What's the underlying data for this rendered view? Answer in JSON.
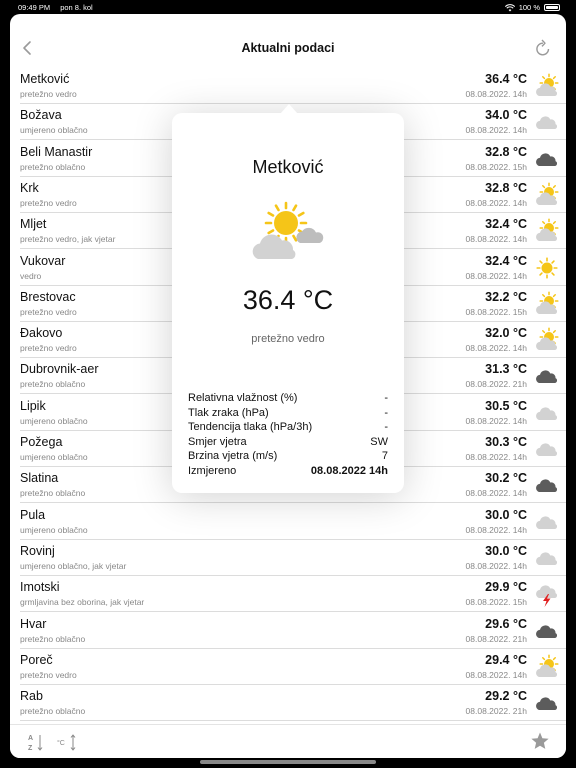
{
  "status_bar": {
    "time": "09:49 PM",
    "date": "pon 8. kol",
    "battery": "100 %"
  },
  "header": {
    "title": "Aktualni podaci"
  },
  "stations": [
    {
      "city": "Metković",
      "desc": "pretežno vedro",
      "temp": "36.4 °C",
      "date": "08.08.2022. 14h",
      "icon": "partly-sunny-icon"
    },
    {
      "city": "Božava",
      "desc": "umjereno oblačno",
      "temp": "34.0 °C",
      "date": "08.08.2022. 14h",
      "icon": "cloud-icon"
    },
    {
      "city": "Beli Manastir",
      "desc": "pretežno oblačno",
      "temp": "32.8 °C",
      "date": "08.08.2022. 15h",
      "icon": "dark-cloud-icon"
    },
    {
      "city": "Krk",
      "desc": "pretežno vedro",
      "temp": "32.8 °C",
      "date": "08.08.2022. 14h",
      "icon": "partly-sunny-icon"
    },
    {
      "city": "Mljet",
      "desc": "pretežno vedro, jak vjetar",
      "temp": "32.4 °C",
      "date": "08.08.2022. 14h",
      "icon": "partly-sunny-icon"
    },
    {
      "city": "Vukovar",
      "desc": "vedro",
      "temp": "32.4 °C",
      "date": "08.08.2022. 14h",
      "icon": "sun-icon"
    },
    {
      "city": "Brestovac",
      "desc": "pretežno vedro",
      "temp": "32.2 °C",
      "date": "08.08.2022. 15h",
      "icon": "partly-sunny-icon"
    },
    {
      "city": "Đakovo",
      "desc": "pretežno vedro",
      "temp": "32.0 °C",
      "date": "08.08.2022. 14h",
      "icon": "partly-sunny-icon"
    },
    {
      "city": "Dubrovnik-aer",
      "desc": "pretežno oblačno",
      "temp": "31.3 °C",
      "date": "08.08.2022. 21h",
      "icon": "dark-cloud-icon"
    },
    {
      "city": "Lipik",
      "desc": "umjereno oblačno",
      "temp": "30.5 °C",
      "date": "08.08.2022. 14h",
      "icon": "cloud-icon"
    },
    {
      "city": "Požega",
      "desc": "umjereno oblačno",
      "temp": "30.3 °C",
      "date": "08.08.2022. 14h",
      "icon": "cloud-icon"
    },
    {
      "city": "Slatina",
      "desc": "pretežno oblačno",
      "temp": "30.2 °C",
      "date": "08.08.2022. 14h",
      "icon": "dark-cloud-icon"
    },
    {
      "city": "Pula",
      "desc": "umjereno oblačno",
      "temp": "30.0 °C",
      "date": "08.08.2022. 14h",
      "icon": "cloud-icon"
    },
    {
      "city": "Rovinj",
      "desc": "umjereno oblačno, jak vjetar",
      "temp": "30.0 °C",
      "date": "08.08.2022. 14h",
      "icon": "cloud-icon"
    },
    {
      "city": "Imotski",
      "desc": "grmljavina bez oborina, jak vjetar",
      "temp": "29.9 °C",
      "date": "08.08.2022. 15h",
      "icon": "thunder-cloud-icon"
    },
    {
      "city": "Hvar",
      "desc": "pretežno oblačno",
      "temp": "29.6 °C",
      "date": "08.08.2022. 21h",
      "icon": "dark-cloud-icon"
    },
    {
      "city": "Poreč",
      "desc": "pretežno vedro",
      "temp": "29.4 °C",
      "date": "08.08.2022. 14h",
      "icon": "partly-sunny-icon"
    },
    {
      "city": "Rab",
      "desc": "pretežno oblačno",
      "temp": "29.2 °C",
      "date": "08.08.2022. 21h",
      "icon": "dark-cloud-icon"
    }
  ],
  "popover": {
    "city": "Metković",
    "icon": "partly-sunny-icon",
    "temp": "36.4 °C",
    "desc": "pretežno vedro",
    "details": [
      {
        "label": "Relativna vlažnost (%)",
        "value": "-"
      },
      {
        "label": "Tlak zraka (hPa)",
        "value": "-"
      },
      {
        "label": "Tendencija tlaka (hPa/3h)",
        "value": "-"
      },
      {
        "label": "Smjer vjetra",
        "value": "SW"
      },
      {
        "label": "Brzina vjetra (m/s)",
        "value": "7"
      },
      {
        "label": "Izmjereno",
        "value": "08.08.2022 14h"
      }
    ]
  },
  "toolbar": {
    "sort_az_top": "A",
    "sort_az_bottom": "Z",
    "sort_temp": "°C"
  },
  "colors": {
    "sun": "#F5C518",
    "cloud_light": "#D2D2D2",
    "cloud_dark": "#5C5C5C",
    "lightning": "#E02020",
    "accent_gray": "#9A9A9A"
  }
}
